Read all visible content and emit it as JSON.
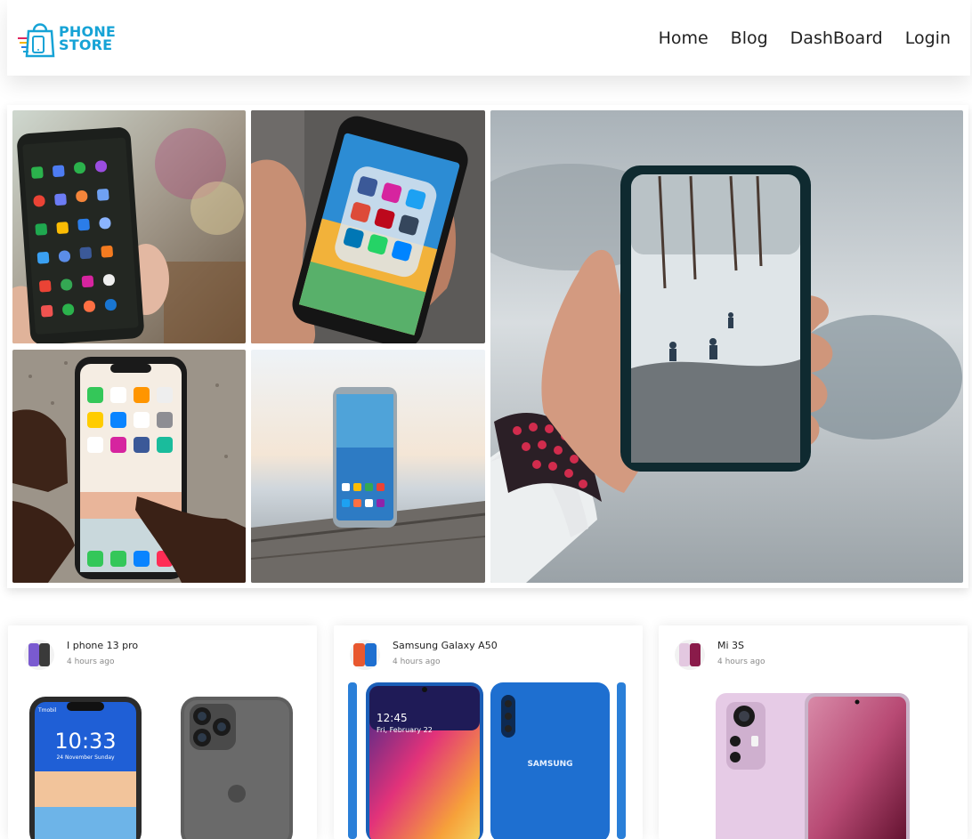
{
  "brand": {
    "line1": "PHONE",
    "line2": "STORE",
    "icon": "shopping-bag-phone-logo"
  },
  "nav": {
    "items": [
      {
        "label": "Home"
      },
      {
        "label": "Blog"
      },
      {
        "label": "DashBoard"
      },
      {
        "label": "Login"
      }
    ]
  },
  "gallery": {
    "images": [
      {
        "name": "android-phone-app-grid-photo"
      },
      {
        "name": "iphone-social-networks-photo"
      },
      {
        "name": "hand-holding-phone-snow-photo"
      },
      {
        "name": "iphone-home-screen-photo"
      },
      {
        "name": "samsung-phone-on-wood-photo"
      }
    ]
  },
  "phone_screen": {
    "time": "10:33",
    "date": "24 November Sunday",
    "carrier": "Tmobil"
  },
  "samsung_screen": {
    "time": "12:45",
    "date": "Fri, February 22",
    "brand": "SAMSUNG"
  },
  "cards": [
    {
      "title": "I phone 13 pro",
      "time": "4 hours ago"
    },
    {
      "title": "Samsung Galaxy A50",
      "time": "4 hours ago"
    },
    {
      "title": "Mi 3S",
      "time": "4 hours ago"
    }
  ]
}
